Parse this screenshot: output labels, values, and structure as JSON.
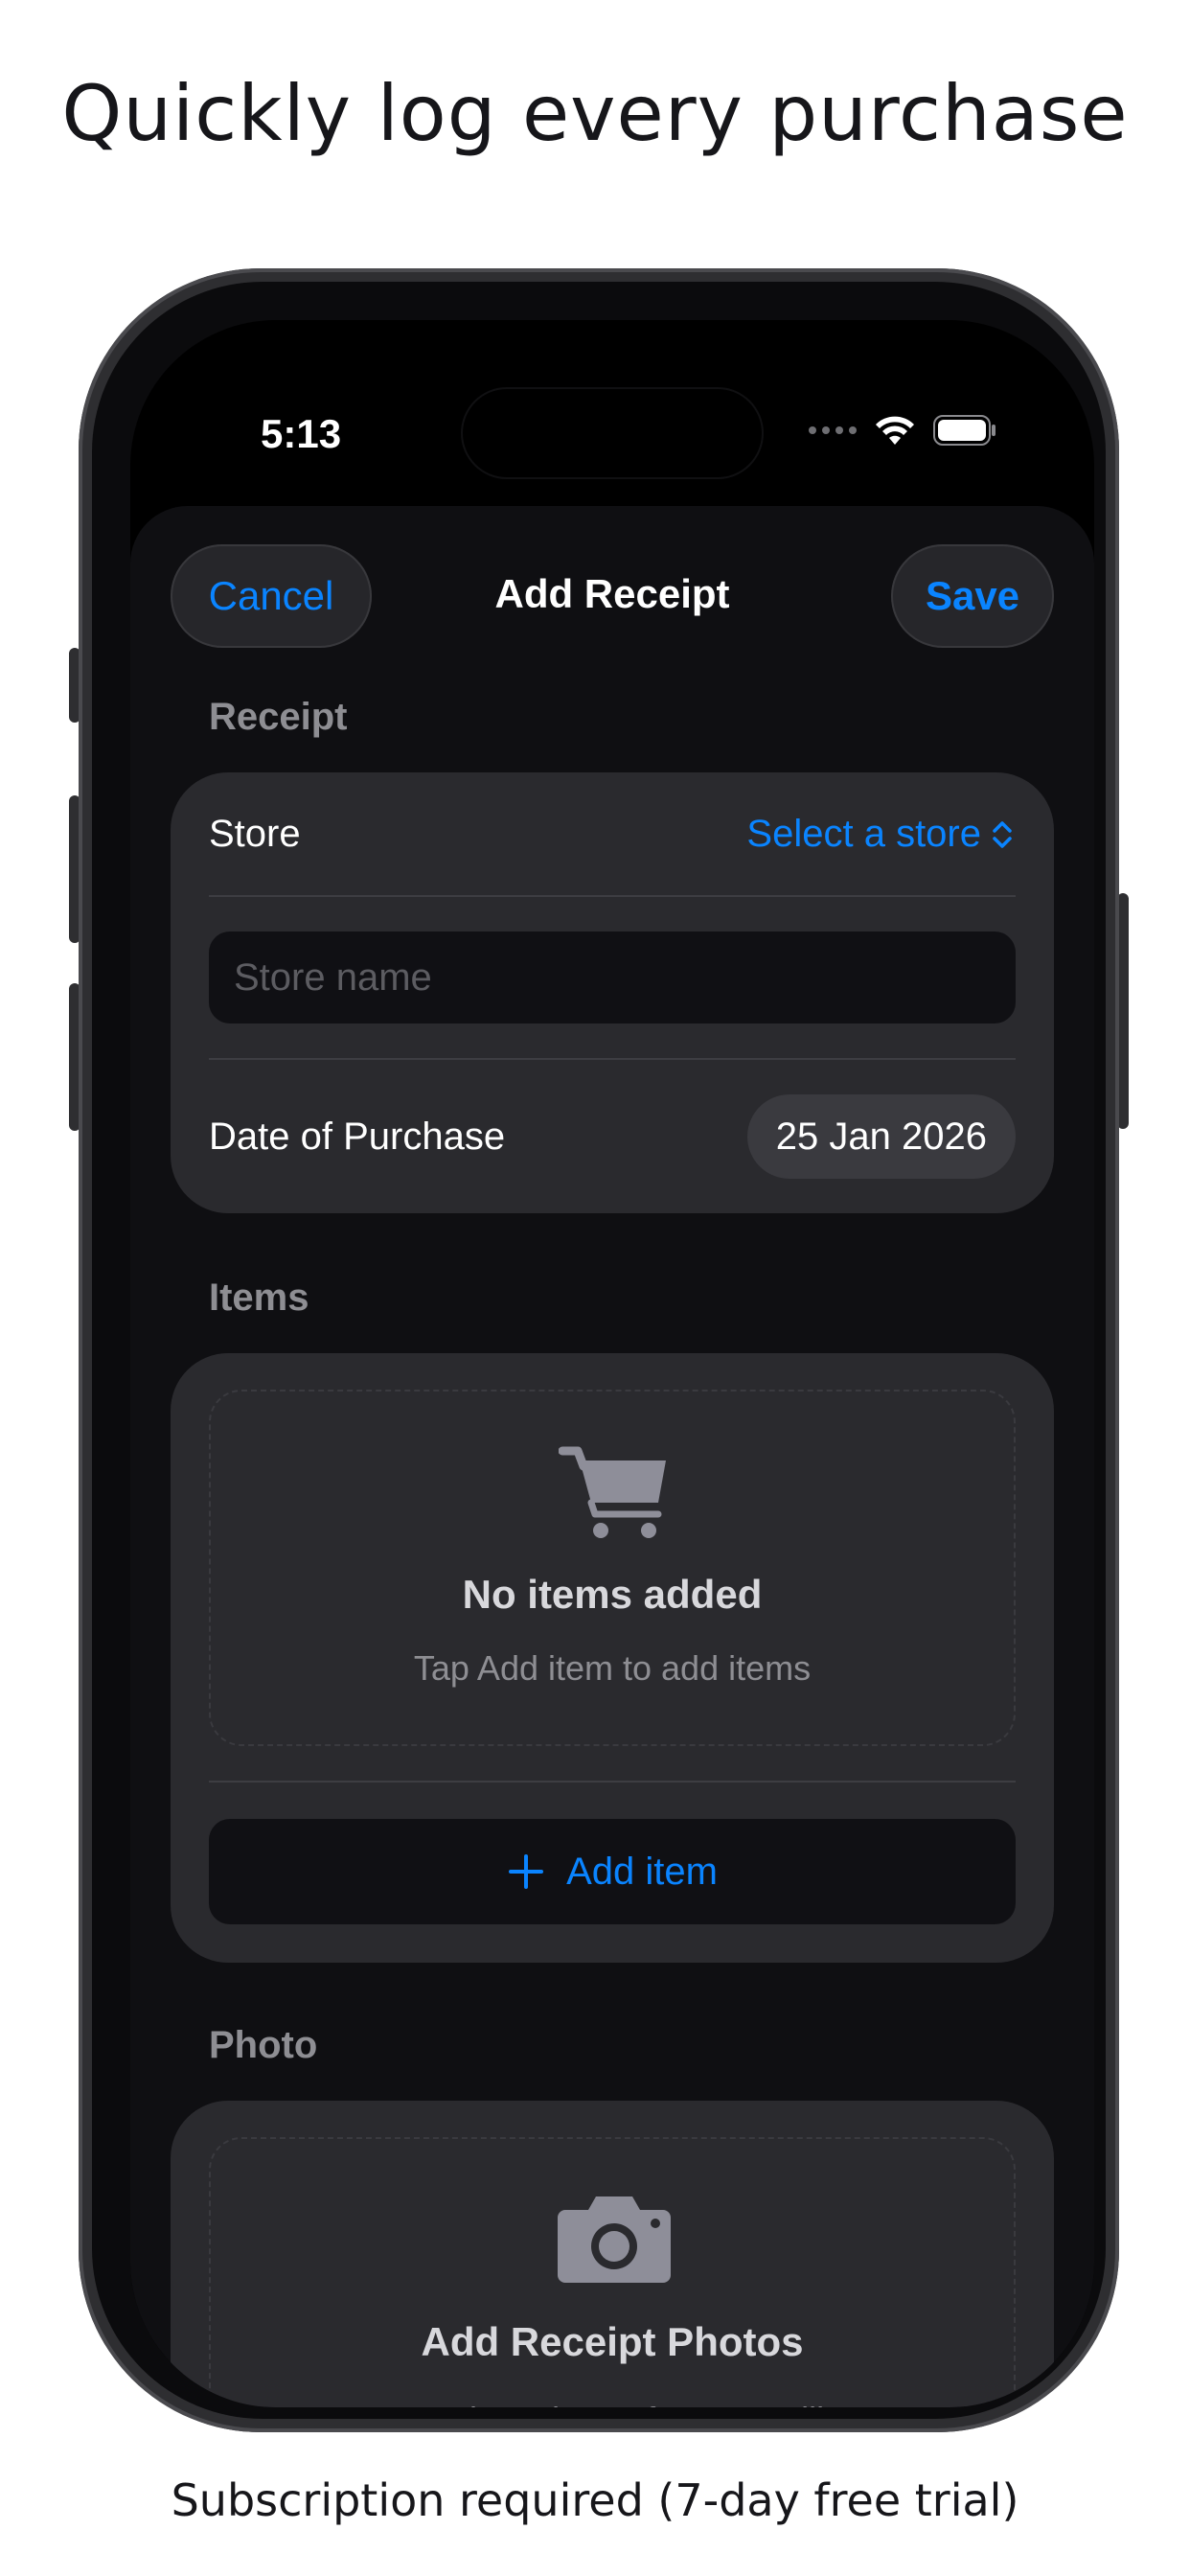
{
  "marketing": {
    "headline": "Quickly log every purchase",
    "footer": "Subscription required (7-day free trial)"
  },
  "status_bar": {
    "time": "5:13",
    "icons": [
      "signal-dots-icon",
      "wifi-icon",
      "battery-icon"
    ]
  },
  "nav": {
    "cancel_label": "Cancel",
    "title": "Add Receipt",
    "save_label": "Save"
  },
  "receipt_section": {
    "header": "Receipt",
    "store_label": "Store",
    "store_picker_value": "Select a store",
    "store_name_placeholder": "Store name",
    "store_name_value": "",
    "date_label": "Date of Purchase",
    "date_value": "25 Jan 2026"
  },
  "items_section": {
    "header": "Items",
    "empty_icon": "cart-icon",
    "empty_title": "No items added",
    "empty_subtitle": "Tap Add item to add items",
    "add_item_label": "Add item"
  },
  "photo_section": {
    "header": "Photo",
    "icon": "camera-icon",
    "title": "Add Receipt Photos",
    "subtitle": "Tap to select photos from your library"
  },
  "colors": {
    "accent": "#0a84ff",
    "card_background": "#2a2a2e",
    "sheet_background": "#0f0f12"
  }
}
